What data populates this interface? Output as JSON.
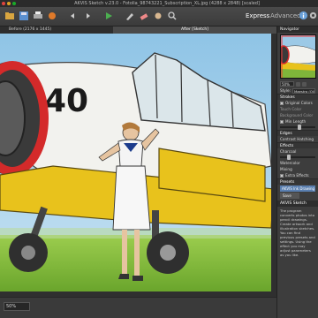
{
  "window": {
    "title": "AKVIS Sketch v.23.0 - Fotolia_98743221_Subscription_XL.jpg (4288 x 2848) [scaled]"
  },
  "toolbar": {
    "mode_express": "Express",
    "mode_advanced": "Advanced"
  },
  "tabs": {
    "before": "Before (2176 x 1445)",
    "after": "After [Sketch]"
  },
  "canvas": {
    "zoom": "50%"
  },
  "navigator": {
    "title": "Navigator",
    "zoom": "50%"
  },
  "settings": {
    "style_label": "Style:",
    "style_value": "Maestro (Oil)",
    "strokes_label": "Strokes",
    "original_colors_label": "Original Colors",
    "touch_color_label": "Touch Color",
    "background_label": "Background Color",
    "min_length_label": "Min Length",
    "edges_label": "Edges",
    "contrast_label": "Contrast Hatching",
    "effects_label": "Effects",
    "charcoal_label": "Charcoal",
    "watercolor_label": "Watercolor",
    "mixing_label": "Mixing",
    "extra_effects_label": "Extra Effects"
  },
  "presets": {
    "title": "Presets",
    "selected": "AKVIS Ink Drawing (Crosshatching)",
    "save_label": "Save"
  },
  "help": {
    "title": "AKVIS Sketch",
    "text": "The program converts photos into pencil drawings. Create artwork and illustration sketches. You can find previous presets and settings. Using the effect you may adjust parameters as you like."
  },
  "colors": {
    "accent": "#5a7fb0",
    "panel_bg": "#3d3d3d",
    "sky": "#9cc9e6",
    "grass": "#7fb53a",
    "plane_yellow": "#e8c21c"
  }
}
